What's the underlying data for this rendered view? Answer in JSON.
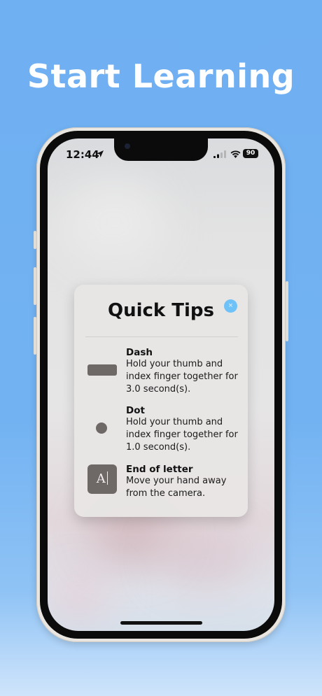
{
  "headline": "Start Learning",
  "status_bar": {
    "time": "12:44",
    "battery": "90",
    "icons": [
      "location-arrow-icon",
      "cellular-signal-icon",
      "wifi-icon",
      "battery-icon"
    ]
  },
  "quick_tips": {
    "title": "Quick Tips",
    "close_label": "×",
    "tips": [
      {
        "icon": "dash-icon",
        "title": "Dash",
        "desc_lines": [
          "Hold your thumb and",
          "index finger together for",
          "3.0 second(s)."
        ]
      },
      {
        "icon": "dot-icon",
        "title": "Dot",
        "desc_lines": [
          "Hold your thumb and",
          "index finger together for",
          "1.0 second(s)."
        ]
      },
      {
        "icon": "end-of-letter-icon",
        "icon_text": "A",
        "title": "End of letter",
        "desc_lines": [
          "Move your hand away",
          "from the camera."
        ]
      }
    ]
  },
  "colors": {
    "background": "#72b2f2",
    "close_button": "#6fc2f7",
    "tip_icon": "#6e6867"
  }
}
